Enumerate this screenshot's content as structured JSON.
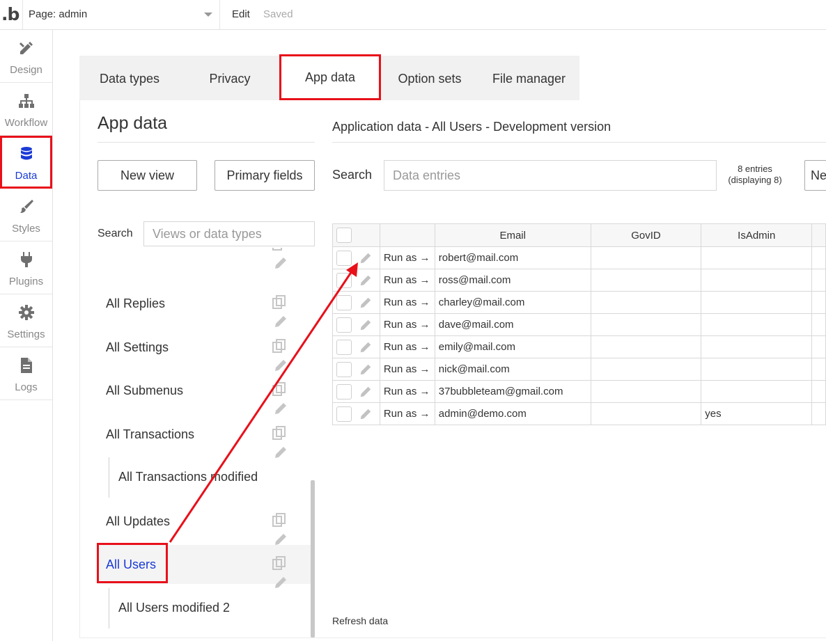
{
  "topbar": {
    "logo": ".b",
    "page_label": "Page: admin",
    "edit_label": "Edit",
    "saved_label": "Saved"
  },
  "nav": {
    "items": [
      {
        "label": "Design",
        "icon": "design-icon"
      },
      {
        "label": "Workflow",
        "icon": "workflow-icon"
      },
      {
        "label": "Data",
        "icon": "database-icon"
      },
      {
        "label": "Styles",
        "icon": "brush-icon"
      },
      {
        "label": "Plugins",
        "icon": "plug-icon"
      },
      {
        "label": "Settings",
        "icon": "gear-icon"
      },
      {
        "label": "Logs",
        "icon": "document-icon"
      }
    ],
    "active": "Data"
  },
  "tabs": [
    {
      "label": "Data types"
    },
    {
      "label": "Privacy"
    },
    {
      "label": "App data"
    },
    {
      "label": "Option sets"
    },
    {
      "label": "File manager"
    }
  ],
  "left_panel": {
    "title": "App data",
    "new_view_label": "New view",
    "primary_fields_label": "Primary fields",
    "search_label": "Search",
    "search_placeholder": "Views or data types",
    "views": [
      {
        "label": "All Replies"
      },
      {
        "label": "All Settings"
      },
      {
        "label": "All Submenus"
      },
      {
        "label": "All Transactions"
      },
      {
        "label": "All Transactions modified"
      },
      {
        "label": "All Updates"
      },
      {
        "label": "All Users"
      },
      {
        "label": "All Users modified 2"
      }
    ]
  },
  "main": {
    "title": "Application data - All Users - Development version",
    "search_label": "Search",
    "search_placeholder": "Data entries",
    "entries_count": "8 entries",
    "entries_displaying": "(displaying 8)",
    "new_button_label": "Ne",
    "columns": [
      "Email",
      "GovID",
      "IsAdmin"
    ],
    "run_as_label": "Run as →",
    "rows": [
      {
        "email": "robert@mail.com",
        "govid": "",
        "isadmin": ""
      },
      {
        "email": "ross@mail.com",
        "govid": "",
        "isadmin": ""
      },
      {
        "email": "charley@mail.com",
        "govid": "",
        "isadmin": ""
      },
      {
        "email": "dave@mail.com",
        "govid": "",
        "isadmin": ""
      },
      {
        "email": "emily@mail.com",
        "govid": "",
        "isadmin": ""
      },
      {
        "email": "nick@mail.com",
        "govid": "",
        "isadmin": ""
      },
      {
        "email": "37bubbleteam@gmail.com",
        "govid": "",
        "isadmin": ""
      },
      {
        "email": "admin@demo.com",
        "govid": "",
        "isadmin": "yes"
      }
    ],
    "refresh_label": "Refresh data"
  },
  "colors": {
    "highlight": "#e8101a",
    "accent": "#1a3ad6"
  }
}
